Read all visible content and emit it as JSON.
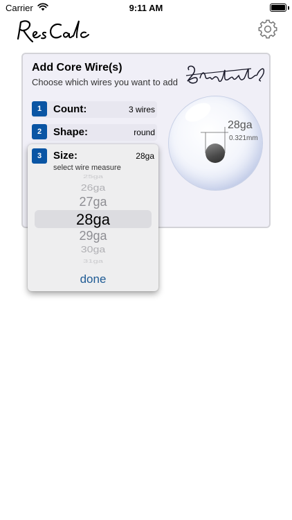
{
  "status_bar": {
    "carrier": "Carrier",
    "time": "9:11 AM",
    "wifi_icon": "wifi-icon",
    "battery_icon": "battery-icon"
  },
  "header": {
    "logo_text": "Res Calc",
    "settings_icon": "gear-icon"
  },
  "card": {
    "title": "Add Core Wire(s)",
    "subtitle": "Choose which wires you want to add",
    "signature_text": "BlendStyle",
    "rows": [
      {
        "number": "1",
        "label": "Count:",
        "value": "3 wires"
      },
      {
        "number": "2",
        "label": "Shape:",
        "value": "round"
      }
    ],
    "preview": {
      "gauge": "28ga",
      "diameter": "0.321mm"
    }
  },
  "picker": {
    "number": "3",
    "label": "Size:",
    "value": "28ga",
    "hint": "select wire measure",
    "options": [
      "25ga",
      "26ga",
      "27ga",
      "28ga",
      "29ga",
      "30ga",
      "31ga"
    ],
    "selected": "28ga",
    "done_label": "done"
  },
  "colors": {
    "accent": "#0a55a4",
    "done": "#1f5b94",
    "card_bg": "#f0eff7"
  }
}
